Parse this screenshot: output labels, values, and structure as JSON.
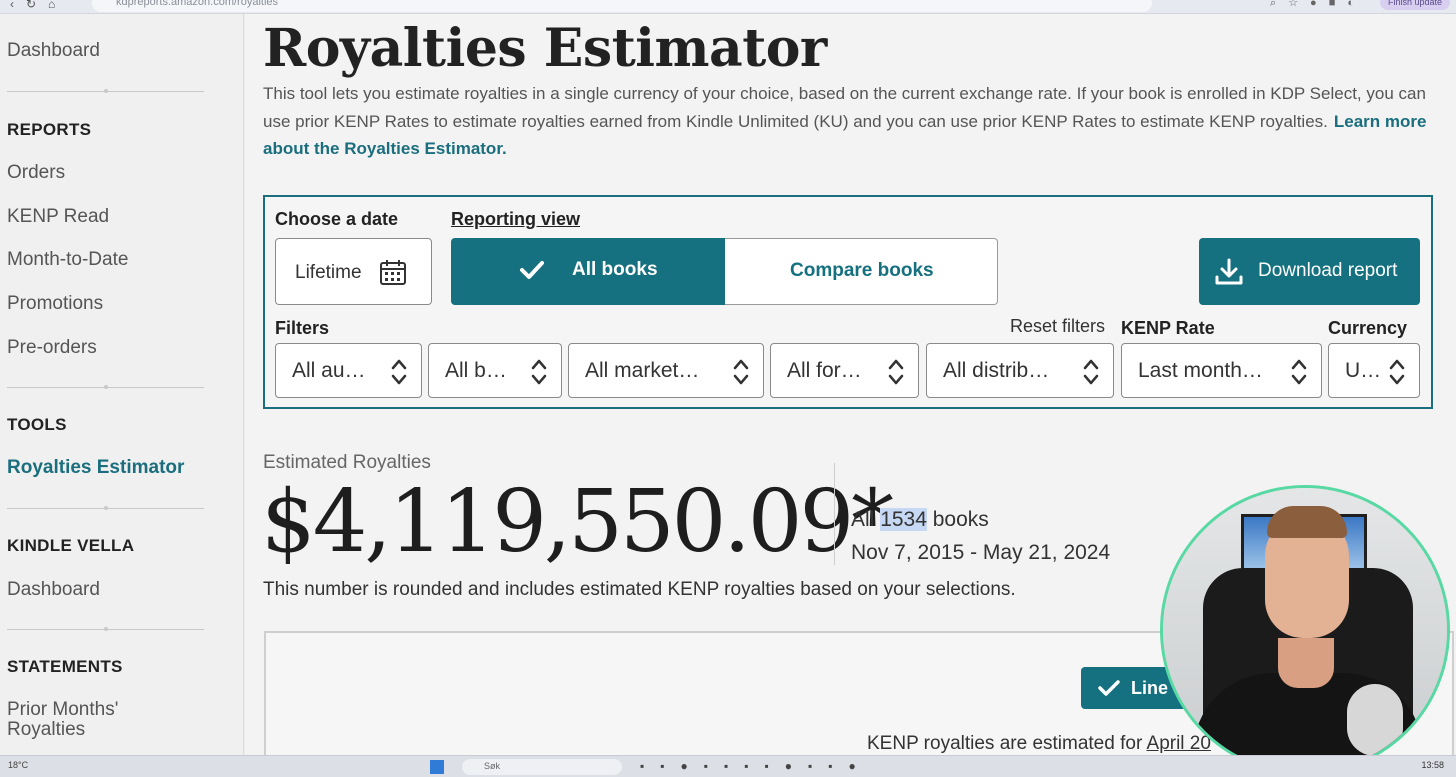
{
  "browser": {
    "url": "kdpreports.amazon.com/royalties",
    "update_label": "Finish update"
  },
  "sidebar": {
    "dashboard": "Dashboard",
    "reports_heading": "REPORTS",
    "reports_items": [
      "Orders",
      "KENP Read",
      "Month-to-Date",
      "Promotions",
      "Pre-orders"
    ],
    "tools_heading": "TOOLS",
    "tools_active": "Royalties Estimator",
    "vella_heading": "KINDLE VELLA",
    "vella_dashboard": "Dashboard",
    "statements_heading": "STATEMENTS",
    "statements_item": "Prior Months' Royalties"
  },
  "main": {
    "title": "Royalties Estimator",
    "intro": "This tool lets you estimate royalties in a single currency of your choice, based on the current exchange rate. If your book is enrolled in KDP Select, you can use prior KENP Rates to estimate royalties earned from Kindle Unlimited (KU) and you can use prior KENP Rates to estimate KENP royalties.",
    "learn_more": "Learn more about the Royalties Estimator."
  },
  "filters_panel": {
    "choose_date_label": "Choose a date",
    "date_value": "Lifetime",
    "reporting_view_label": "Reporting view",
    "all_books": "All books",
    "compare_books": "Compare books",
    "download_report": "Download report",
    "filters_label": "Filters",
    "reset_filters": "Reset filters",
    "kenp_rate_label": "KENP Rate",
    "currency_label": "Currency",
    "selects": {
      "authors": "All au…",
      "books": "All b…",
      "marketplaces": "All market…",
      "formats": "All for…",
      "distribution": "All distrib…",
      "kenp_rate": "Last month…",
      "currency": "U…"
    }
  },
  "results": {
    "estimated_label": "Estimated Royalties",
    "amount": "$4,119,550.09*",
    "books_prefix": "All",
    "books_count": "1534",
    "books_suffix": "books",
    "date_range": "Nov 7, 2015 - May 21, 2024",
    "note": "This number is rounded and includes estimated KENP royalties based on your selections.",
    "line_button": "Line c",
    "kenp_note_prefix": "KENP royalties are estimated for",
    "kenp_note_link": "April 20"
  },
  "taskbar": {
    "temperature": "18°C",
    "search_placeholder": "Søk",
    "clock": "13:58"
  },
  "colors": {
    "accent": "#15707f",
    "link": "#1a6e7e",
    "selection_highlight": "#c6d8f3",
    "webcam_ring": "#58d9a3"
  }
}
